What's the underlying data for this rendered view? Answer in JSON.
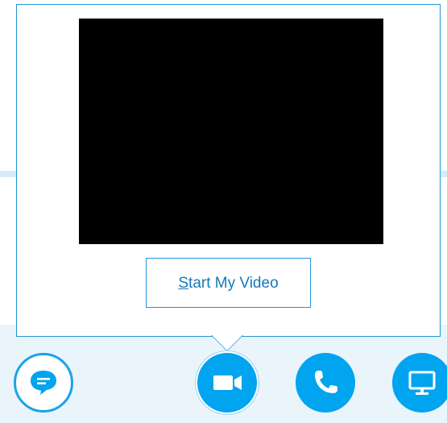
{
  "popup": {
    "start_video_label_accel": "S",
    "start_video_label_rest": "tart My Video"
  },
  "controls": {
    "chat_icon": "chat-bubble-icon",
    "video_icon": "video-camera-icon",
    "call_icon": "phone-icon",
    "share_icon": "monitor-icon"
  },
  "colors": {
    "accent": "#00a4ef",
    "border": "#2196d6",
    "text_link": "#1579b8"
  }
}
